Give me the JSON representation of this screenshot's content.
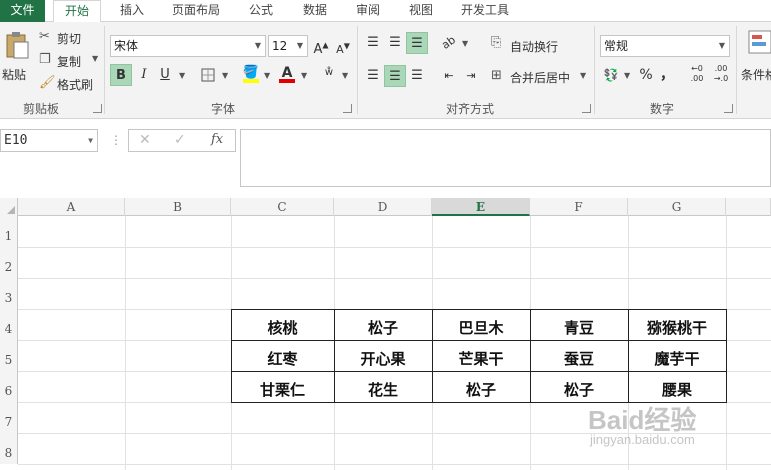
{
  "tabs": [
    "文件",
    "开始",
    "插入",
    "页面布局",
    "公式",
    "数据",
    "审阅",
    "视图",
    "开发工具"
  ],
  "clipboard": {
    "paste": "粘贴",
    "cut": "剪切",
    "copy": "复制",
    "format_painter": "格式刷",
    "label": "剪贴板"
  },
  "font": {
    "name": "宋体",
    "size": "12",
    "bold": "B",
    "italic": "I",
    "underline": "U",
    "label": "字体"
  },
  "alignment": {
    "wrap_text": "自动换行",
    "merge_center": "合并后居中",
    "label": "对齐方式"
  },
  "number": {
    "format": "常规",
    "percent": "%",
    "comma": "，",
    "label": "数字"
  },
  "styles": {
    "conditional": "条件格"
  },
  "formula_bar": {
    "name_box": "E10",
    "fx": "fx",
    "formula": ""
  },
  "columns": [
    "A",
    "B",
    "C",
    "D",
    "E",
    "F",
    "G"
  ],
  "rows": [
    "1",
    "2",
    "3",
    "4",
    "5",
    "6",
    "7",
    "8"
  ],
  "selected_column": "E",
  "table": [
    [
      "核桃",
      "松子",
      "巴旦木",
      "青豆",
      "猕猴桃干"
    ],
    [
      "红枣",
      "开心果",
      "芒果干",
      "蚕豆",
      "魔芋干"
    ],
    [
      "甘栗仁",
      "花生",
      "松子",
      "松子",
      "腰果"
    ]
  ],
  "watermark": {
    "main": "Baid经验",
    "sub": "jingyan.baidu.com"
  },
  "colors": {
    "accent": "#217346",
    "selected_button": "#a9d7b8"
  }
}
